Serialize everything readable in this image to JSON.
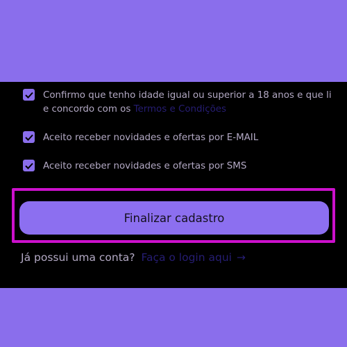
{
  "checkboxes": [
    {
      "checked": true,
      "line1": "Confirmo que tenho idade igual ou superior a 18 anos e que li",
      "line2_prefix": "e concordo com os ",
      "link": "Termos e Condições"
    },
    {
      "checked": true,
      "label": "Aceito receber novidades e ofertas por E-MAIL"
    },
    {
      "checked": true,
      "label": "Aceito receber novidades e ofertas por SMS"
    }
  ],
  "submit_label": "Finalizar cadastro",
  "login": {
    "prompt": "Já possui uma conta?",
    "link": "Faça o login aqui",
    "arrow": "→"
  },
  "colors": {
    "background": "#8a6eec",
    "panel": "#000000",
    "button": "#8c6ff0",
    "highlight": "#cc10cc",
    "link": "#261d73"
  }
}
